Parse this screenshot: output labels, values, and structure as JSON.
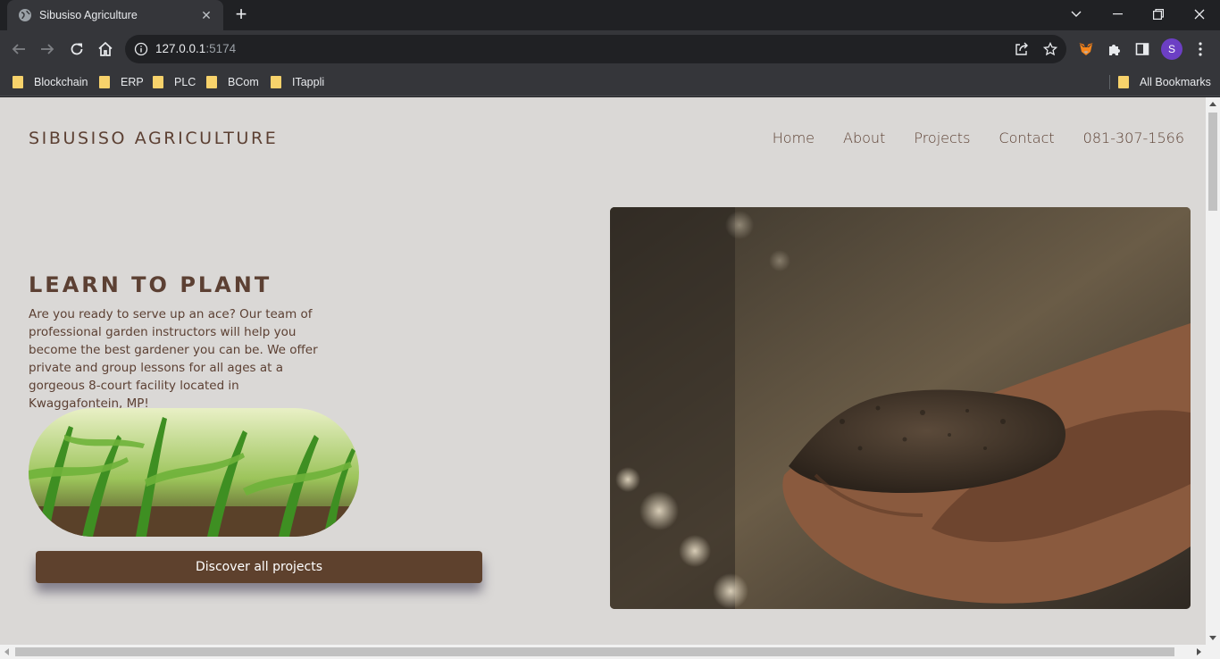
{
  "browser": {
    "tab_title": "Sibusiso Agriculture",
    "url_host": "127.0.0.1",
    "url_port": ":5174",
    "profile_initial": "S",
    "bookmarks": [
      "Blockchain",
      "ERP",
      "PLC",
      "BCom",
      "ITappli"
    ],
    "all_bookmarks_label": "All Bookmarks"
  },
  "site": {
    "brand": "SIBUSISO AGRICULTURE",
    "nav": [
      "Home",
      "About",
      "Projects",
      "Contact",
      "081-307-1566"
    ],
    "headline": "LEARN TO PLANT",
    "intro": "Are you ready to serve up an ace? Our team of professional garden instructors will help you become the best gardener you can be. We offer private and group lessons for all ages at a gorgeous 8-court facility located in Kwaggafontein, MP!",
    "cta_label": "Discover all projects"
  },
  "icons": {
    "tab_favicon": "globe-icon",
    "omnibox_left": "info-icon",
    "colors": {
      "brand_brown": "#5c4033",
      "button_brown": "#5e412d",
      "page_bg": "#dad8d6"
    }
  }
}
